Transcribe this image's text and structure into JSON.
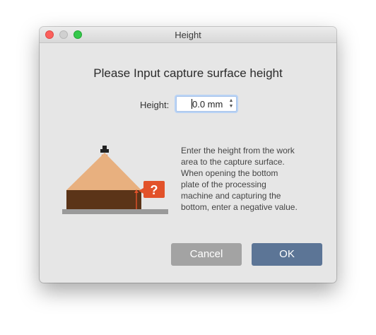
{
  "window": {
    "title": "Height"
  },
  "dialog": {
    "heading": "Please Input capture surface height",
    "height_label": "Height:",
    "height_value": "0.0 mm",
    "help_text": "Enter the height from the work\narea to the capture surface.\nWhen opening the bottom\nplate of the processing\nmachine and capturing the\nbottom, enter a negative value.",
    "help_badge": "?"
  },
  "buttons": {
    "cancel_label": "Cancel",
    "ok_label": "OK"
  },
  "colors": {
    "cancel_button": "#a3a3a3",
    "ok_button": "#5c7596",
    "cone": "#e8b07f",
    "block": "#5b3418",
    "badge": "#e2522a",
    "base": "#9a9a9a"
  },
  "icons": {
    "stepper": "up-down-chevron",
    "illustration": "camera-capture-height-diagram",
    "badge": "question-mark"
  }
}
